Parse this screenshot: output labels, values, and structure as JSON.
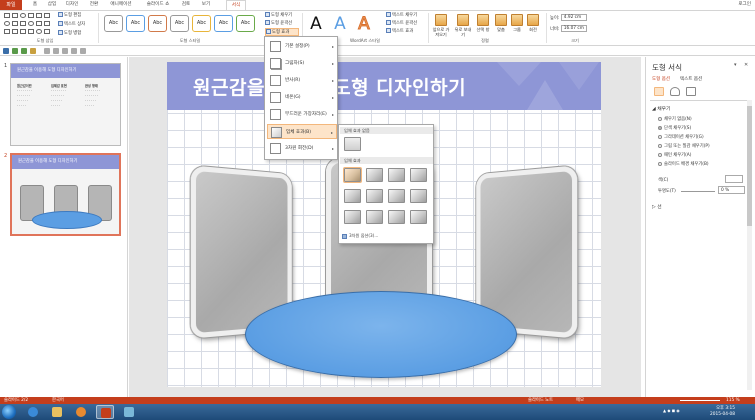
{
  "app": {
    "file_tab": "파일",
    "tabs": [
      "홈",
      "삽입",
      "디자인",
      "전환",
      "애니메이션",
      "슬라이드 쇼",
      "검토",
      "보기",
      "서식"
    ],
    "active_tab": "서식",
    "signin": "로그인"
  },
  "ribbon": {
    "groups": {
      "insert_shapes": "도형 삽입",
      "shape_styles": "도형 스타일",
      "wordart_styles": "WordArt 스타일",
      "arrange": "정렬",
      "size": "크기"
    },
    "edit_shape": "도형 편집",
    "text_box": "텍스트 상자",
    "merge_shapes": "도형 병합",
    "shape_fill": "도형 채우기",
    "shape_outline": "도형 윤곽선",
    "shape_effects": "도형 효과",
    "style_sample": "Abc",
    "text_fill": "텍스트 채우기",
    "text_outline": "텍스트 윤곽선",
    "text_effects": "텍스트 효과",
    "wordart_letter": "A",
    "bring_forward": "앞으로 가져오기",
    "send_backward": "뒤로 보내기",
    "selection_pane": "선택 창",
    "align": "맞춤",
    "group": "그룹",
    "rotate": "회전",
    "height_label": "높이:",
    "height_value": "4.92 cm",
    "width_label": "너비:",
    "width_value": "16.07 cm"
  },
  "effects_menu": {
    "items": [
      {
        "label": "기본 설정(P)"
      },
      {
        "label": "그림자(S)"
      },
      {
        "label": "반사(R)"
      },
      {
        "label": "네온(G)"
      },
      {
        "label": "부드러운 가장자리(E)"
      },
      {
        "label": "입체 효과(B)"
      },
      {
        "label": "3차원 회전(D)"
      }
    ],
    "active_index": 5
  },
  "bevel_gallery": {
    "no_bevel_heading": "입체 효과 없음",
    "bevel_heading": "입체 효과",
    "options_label": "3차원 옵션(3)..."
  },
  "slides": {
    "thumbnails": [
      {
        "number": "1",
        "title": "원근감을 이용해 도형 디자인하기",
        "col1_head": "원근감이란",
        "col2_head": "입체감 표현",
        "col3_head": "완성 형태"
      },
      {
        "number": "2",
        "title": "원근감을 이용해 도형 디자인하기"
      }
    ]
  },
  "slide": {
    "title": "원근감을 이용해 도형 디자인하기"
  },
  "format_pane": {
    "title": "도형 서식",
    "tab_shape": "도형 옵션",
    "tab_text": "텍스트 옵션",
    "fill_section": "채우기",
    "fill_options": [
      {
        "label": "채우기 없음(N)",
        "selected": false
      },
      {
        "label": "단색 채우기(S)",
        "selected": true
      },
      {
        "label": "그라데이션 채우기(G)",
        "selected": false
      },
      {
        "label": "그림 또는 질감 채우기(P)",
        "selected": false
      },
      {
        "label": "패턴 채우기(A)",
        "selected": false
      },
      {
        "label": "슬라이드 배경 채우기(B)",
        "selected": false
      }
    ],
    "color_label": "색(C)",
    "transparency_label": "투명도(T)",
    "transparency_value": "0 %",
    "line_section": "선"
  },
  "status": {
    "slide_info": "슬라이드 2/2",
    "language": "한국어",
    "notes": "슬라이드 노트",
    "comments": "메모",
    "zoom": "115 %"
  },
  "taskbar": {
    "time": "오후 3:15",
    "date": "2015-04-08"
  },
  "colors": {
    "accent": "#c43e1c",
    "title_bar": "#8e96d6",
    "oval_fill": "#5b9ee3"
  }
}
